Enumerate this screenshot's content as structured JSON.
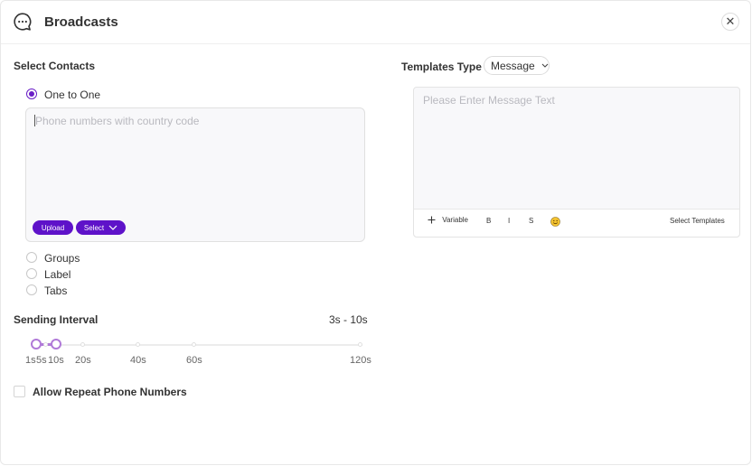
{
  "header": {
    "title": "Broadcasts",
    "close_icon": "close-icon",
    "chat_icon": "chat-bubble-icon"
  },
  "contacts": {
    "section_label": "Select Contacts",
    "options": [
      {
        "label": "One to One",
        "selected": true
      },
      {
        "label": "Groups",
        "selected": false
      },
      {
        "label": "Label",
        "selected": false
      },
      {
        "label": "Tabs",
        "selected": false
      }
    ],
    "phone_placeholder": "Phone numbers with country code",
    "upload_label": "Upload",
    "select_label": "Select"
  },
  "interval": {
    "label": "Sending Interval",
    "value_text": "3s - 10s",
    "ticks": [
      "1s",
      "5s",
      "10s",
      "20s",
      "40s",
      "60s",
      "120s"
    ],
    "range": [
      1,
      10
    ],
    "accent": "#b07ad8"
  },
  "repeat": {
    "label": "Allow Repeat Phone Numbers",
    "checked": false
  },
  "templates": {
    "type_label": "Templates Type",
    "type_value": "Message",
    "message_placeholder": "Please Enter Message Text",
    "toolbar": {
      "variable_label": "Variable",
      "bold": "B",
      "italic": "I",
      "strike": "S",
      "emoji_icon": "emoji-icon",
      "select_templates": "Select Templates"
    }
  },
  "colors": {
    "accent": "#5e12c9",
    "radio": "#6a1ec7"
  }
}
